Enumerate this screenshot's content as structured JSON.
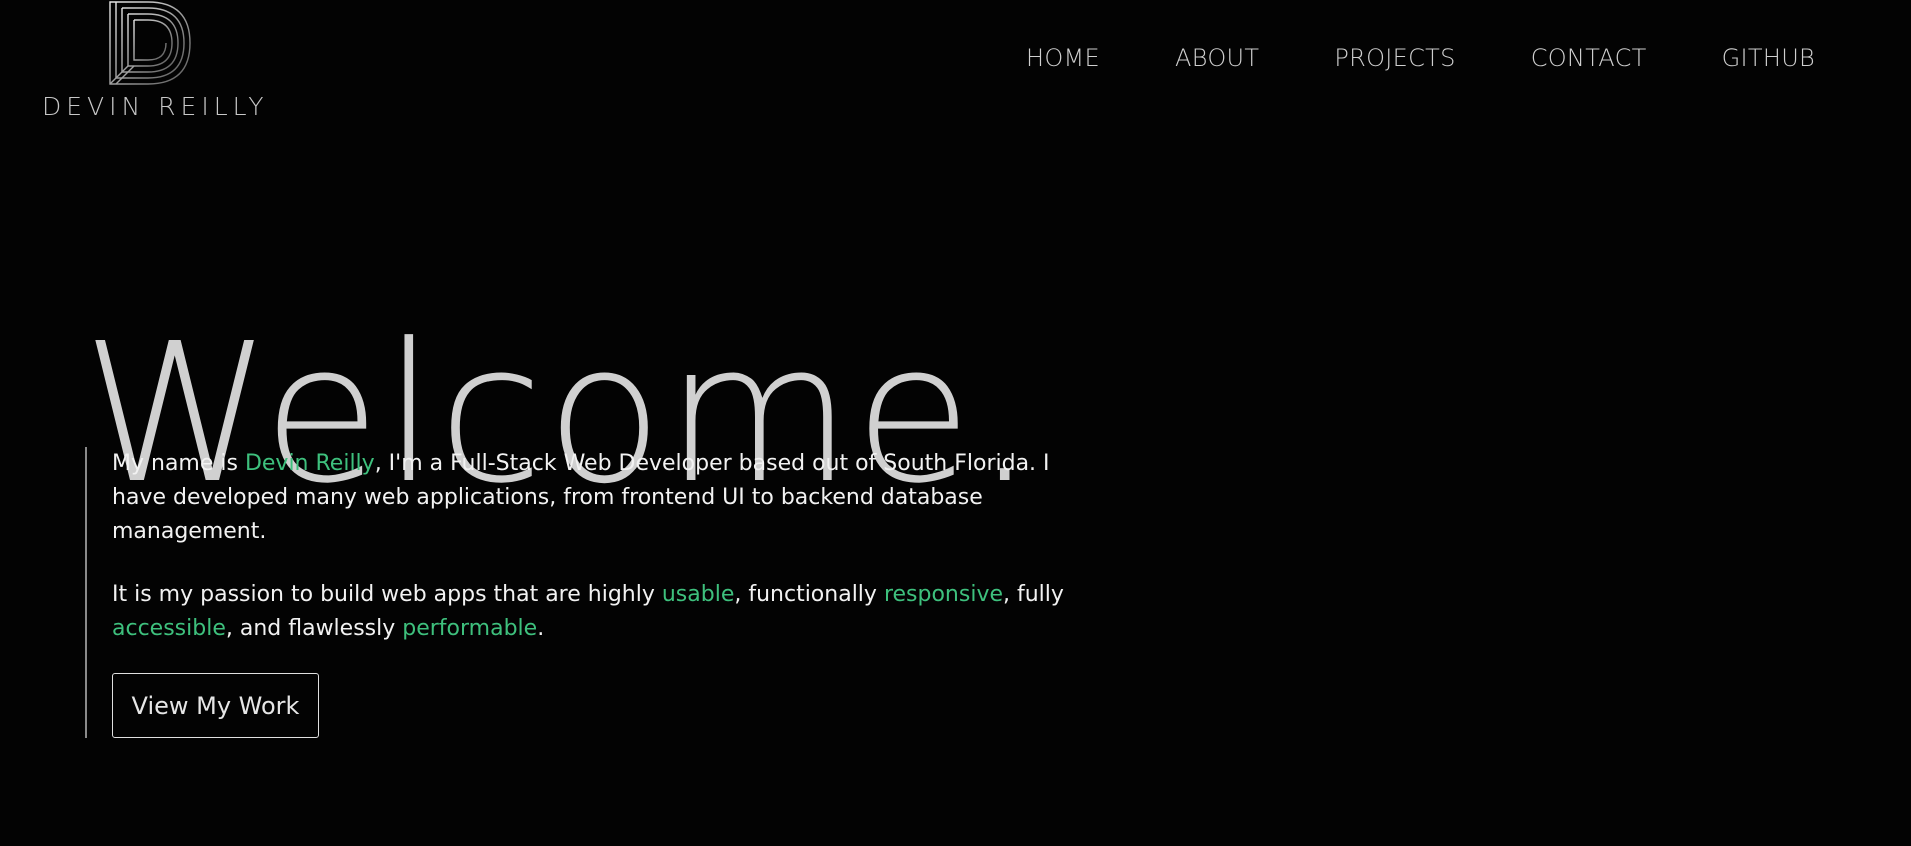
{
  "brand": {
    "name": "DEVIN REILLY",
    "logo_icon": "d-monogram-logo"
  },
  "nav": {
    "items": [
      {
        "label": "HOME"
      },
      {
        "label": "ABOUT"
      },
      {
        "label": "PROJECTS"
      },
      {
        "label": "CONTACT"
      },
      {
        "label": "GITHUB"
      }
    ]
  },
  "hero": {
    "title": "Welcome."
  },
  "intro": {
    "p1": {
      "prefix": "My name is ",
      "name": "Devin Reilly",
      "suffix": ", I'm a Full-Stack Web Developer based out of South Florida. I have developed many web applications, from frontend UI to backend database management."
    },
    "p2": {
      "t1": "It is my passion to build web apps that are highly ",
      "w1": "usable",
      "t2": ", functionally ",
      "w2": "responsive",
      "t3": ", fully ",
      "w3": "accessible",
      "t4": ", and flawlessly ",
      "w4": "performable",
      "t5": "."
    },
    "cta_label": "View My Work"
  },
  "colors": {
    "background": "#030303",
    "accent": "#3ec07d",
    "text": "#f2f2f2",
    "muted": "#cfcfcf"
  }
}
